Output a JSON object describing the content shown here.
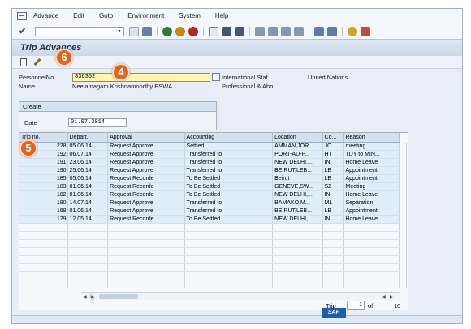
{
  "menu": {
    "items": [
      {
        "ul": "A",
        "rest": "dvance"
      },
      {
        "ul": "E",
        "rest": "dit"
      },
      {
        "ul": "G",
        "rest": "oto"
      },
      {
        "ul": "",
        "rest": "Environment"
      },
      {
        "ul": "",
        "rest": "System"
      },
      {
        "ul": "H",
        "rest": "elp"
      }
    ]
  },
  "toolbar": {
    "command_value": "",
    "dropdown_glyph": "▾"
  },
  "title": "Trip Advances",
  "header": {
    "personnel_label": "PersonnelNo",
    "personnel_value": "836362",
    "personnel_desc": "International Staf",
    "org_desc": "United Nations",
    "name_label": "Name",
    "name_value": "Neelamagam Krishnamoorthy ESWA",
    "category_value": "Professional & Abo"
  },
  "create": {
    "title": "Create",
    "date_label": "Date",
    "date_value": "01.07.2014"
  },
  "table": {
    "columns": [
      "Trip no.",
      "Depart.",
      "Approval",
      "Accounting",
      "Location",
      "Co...",
      "Reason"
    ],
    "rows": [
      [
        "228",
        "05.06.14",
        "Request Approve",
        "Settled",
        "AMMAN,JOR...",
        "JO",
        "meeting"
      ],
      [
        "192",
        "06.07.14",
        "Request Approve",
        "Transferred to",
        "PORT-AU-P...",
        "HT",
        "TDY to MIN..."
      ],
      [
        "191",
        "23.06.14",
        "Request Approve",
        "Transferred to",
        "NEW DELHI,...",
        "IN",
        "Home Leave"
      ],
      [
        "190",
        "25.06.14",
        "Request Approve",
        "Transferred to",
        "BEIRUT,LEB...",
        "LB",
        "Appointment"
      ],
      [
        "185",
        "05.06.14",
        "Request Recorde",
        "To Be Settled",
        "Beirut",
        "LB",
        "Appointment"
      ],
      [
        "183",
        "01.06.14",
        "Request Recorde",
        "To Be Settled",
        "GENEVE,SW...",
        "SZ",
        "Meeting"
      ],
      [
        "182",
        "01.06.14",
        "Request Recorde",
        "To Be Settled",
        "NEW DELHI,...",
        "IN",
        "Home Leave"
      ],
      [
        "180",
        "14.07.14",
        "Request Approve",
        "Transferred to",
        "BAMAKO,M...",
        "ML",
        "Separation"
      ],
      [
        "168",
        "01.06.14",
        "Request Approve",
        "Transferred to",
        "BEIRUT,LEB...",
        "LB",
        "Appointment"
      ],
      [
        "129",
        "12.05.14",
        "Request Recorde",
        "To Be Settled",
        "NEW DELHI,...",
        "IN",
        "Home Leave"
      ]
    ],
    "empty_rows": 8
  },
  "footer": {
    "trip_label": "Trip",
    "current": "1",
    "of_label": "of",
    "total": "10"
  },
  "annotations": {
    "badge_4": "4",
    "badge_5": "5",
    "badge_6": "6",
    "faint_6": "6"
  },
  "logo": "SAP",
  "colors": {
    "badge": "#e0661f",
    "field_yellow": "#fff5b5",
    "sap_blue": "#1a5fae"
  }
}
